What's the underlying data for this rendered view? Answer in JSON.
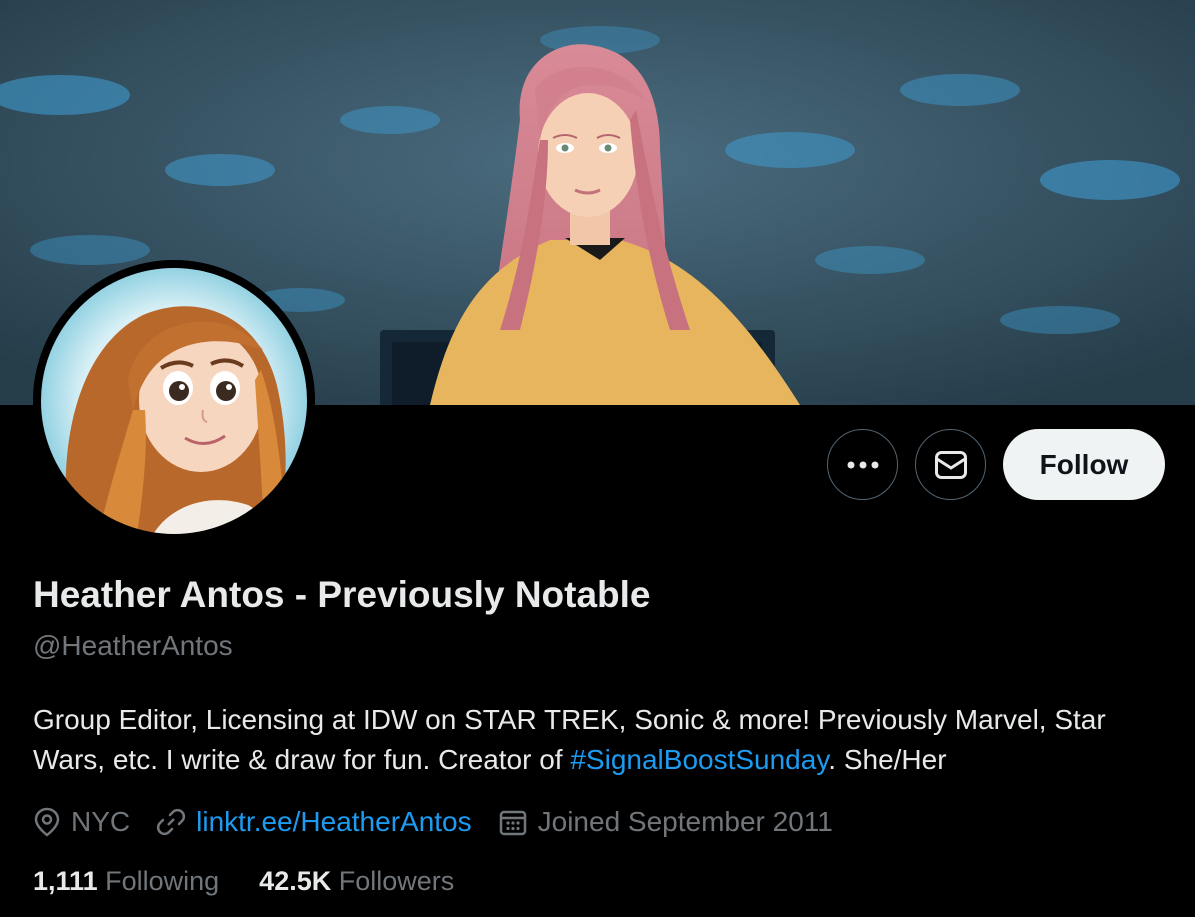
{
  "profile": {
    "display_name": "Heather Antos - Previously Notable",
    "handle": "@HeatherAntos",
    "bio_text_1": "Group Editor, Licensing at IDW on STAR TREK, Sonic & more! Previously Marvel, Star Wars, etc. I write & draw for fun. Creator of ",
    "bio_hashtag": "#SignalBoostSunday",
    "bio_text_2": ". She/Her"
  },
  "meta": {
    "location": "NYC",
    "website": "linktr.ee/HeatherAntos",
    "joined": "Joined September 2011"
  },
  "stats": {
    "following_count": "1,111",
    "following_label": "Following",
    "followers_count": "42.5K",
    "followers_label": "Followers"
  },
  "actions": {
    "follow_label": "Follow"
  },
  "icons": {
    "more": "more-horizontal-icon",
    "message": "mail-icon",
    "location": "location-pin-icon",
    "link": "link-icon",
    "calendar": "calendar-icon"
  },
  "colors": {
    "background": "#000000",
    "accent": "#1d9bf0",
    "secondary_text": "#71767b",
    "primary_text": "#e7e9ea",
    "follow_button_bg": "#eff3f4"
  }
}
